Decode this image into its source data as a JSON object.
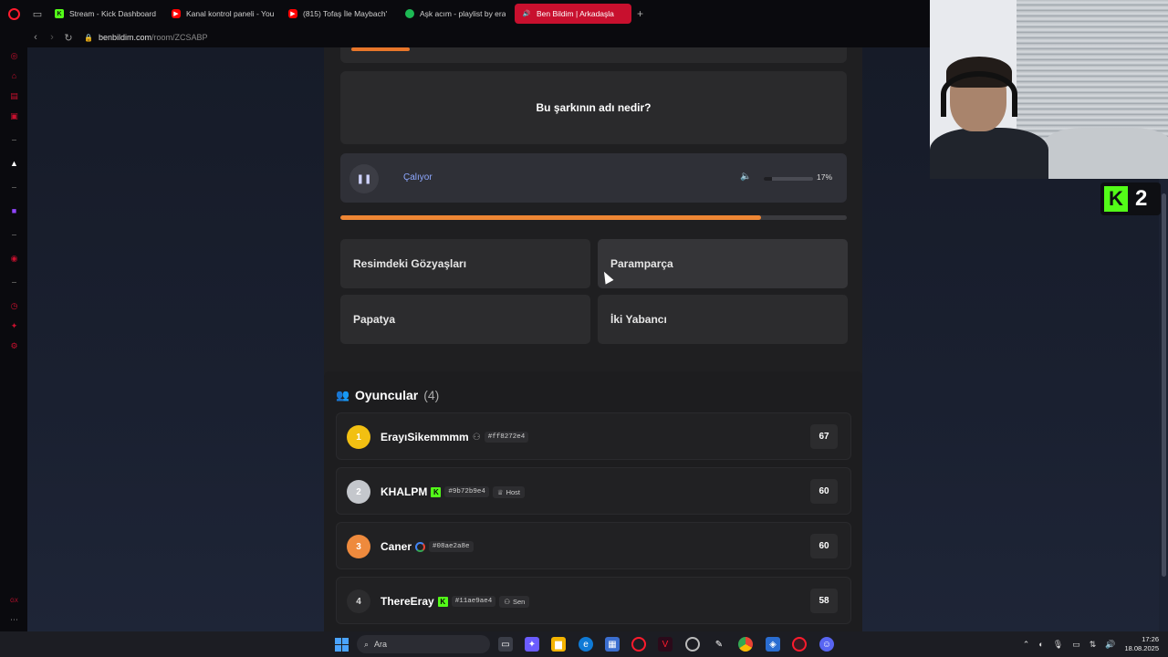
{
  "browser": {
    "tabs": [
      {
        "label": "Stream - Kick Dashboard",
        "favicon": "kick-icon",
        "color": "#53fc18"
      },
      {
        "label": "Kanal kontrol paneli - You",
        "favicon": "youtube-icon",
        "color": "#ff0000"
      },
      {
        "label": "(815) Tofaş İle Maybach'",
        "favicon": "youtube-icon",
        "color": "#ff0000"
      },
      {
        "label": "Aşk acım - playlist by era",
        "favicon": "spotify-icon",
        "color": "#1db954"
      },
      {
        "label": "Ben Bildim | Arkadaşla",
        "favicon": "sound-icon",
        "color": "#ffffff"
      }
    ],
    "url_host": "benbildim.com",
    "url_path": "/room/ZCSABP"
  },
  "game": {
    "question": "Bu şarkının adı nedir?",
    "player_status": "Çalıyor",
    "volume_percent": 17,
    "volume_label": "17%",
    "song_progress": 0.83,
    "answers": [
      {
        "label": "Resimdeki Gözyaşları"
      },
      {
        "label": "Paramparça"
      },
      {
        "label": "Papatya"
      },
      {
        "label": "İki Yabancı"
      }
    ]
  },
  "players": {
    "title": "Oyuncular",
    "count_label": "(4)",
    "list": [
      {
        "rank": "1",
        "name": "ErayıSikemmmm",
        "platform": "user",
        "tag": "#ff8272e4",
        "role": "",
        "score": "67",
        "rank_color": "#f2c012",
        "rank_text": "#fff"
      },
      {
        "rank": "2",
        "name": "KHALPM",
        "platform": "kick",
        "tag": "#9b72b9e4",
        "role": "Host",
        "score": "60",
        "rank_color": "#c4c7cc",
        "rank_text": "#fff"
      },
      {
        "rank": "3",
        "name": "Caner",
        "platform": "google",
        "tag": "#08ae2a8e",
        "role": "",
        "score": "60",
        "rank_color": "#ee8a3d",
        "rank_text": "#fff"
      },
      {
        "rank": "4",
        "name": "ThereEray",
        "platform": "kick",
        "tag": "#11ae9ae4",
        "role": "Sen",
        "score": "58",
        "rank_color": "#2c2c2e",
        "rank_text": "#ddd"
      }
    ]
  },
  "kick_overlay": {
    "count": "2"
  },
  "taskbar": {
    "search_label": "Ara",
    "time": "17:26",
    "date": "18.08.2025"
  },
  "colors": {
    "accent_orange": "#ee8634",
    "kick_green": "#53fc18",
    "opera_red": "#ff1b2d"
  }
}
